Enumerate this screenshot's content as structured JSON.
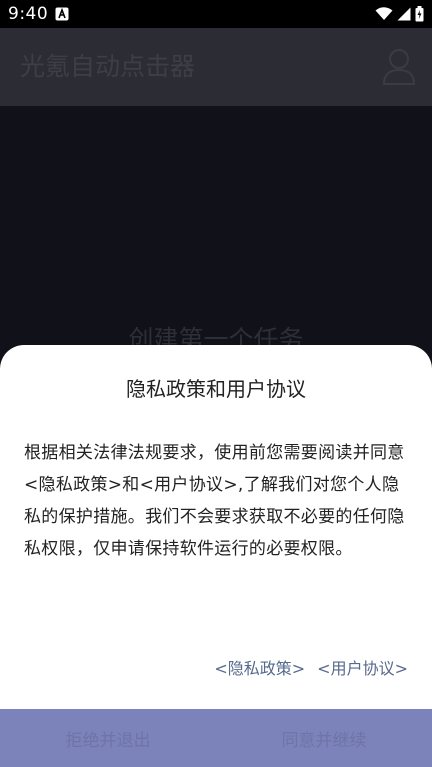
{
  "status_bar": {
    "time": "9:40",
    "icons": [
      "notification-a-icon",
      "wifi-icon",
      "cell-signal-icon",
      "battery-icon"
    ]
  },
  "app_bar": {
    "title": "光氪自动点击器",
    "profile_icon": "person-icon"
  },
  "main": {
    "placeholder_text": "创建第一个任务"
  },
  "dialog": {
    "title": "隐私政策和用户协议",
    "body": "根据相关法律法规要求，使用前您需要阅读并同意<隐私政策>和<用户协议>,了解我们对您个人隐私的保护措施。我们不会要求获取不必要的任何隐私权限，仅申请保持软件运行的必要权限。",
    "links": {
      "privacy_policy": "<隐私政策>",
      "user_agreement": "<用户协议>"
    },
    "buttons": {
      "decline": "拒绝并退出",
      "accept": "同意并继续"
    }
  },
  "colors": {
    "overlay_bg": "#111119",
    "app_bar_bg": "#2c2c34",
    "sheet_bg": "#ffffff",
    "link": "#566a8c",
    "action_bar": "#7c83bb",
    "action_text": "#6e74a6"
  }
}
